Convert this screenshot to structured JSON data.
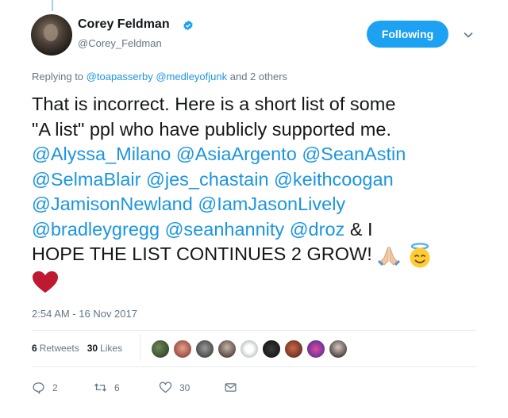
{
  "author": {
    "name": "Corey Feldman",
    "handle": "@Corey_Feldman"
  },
  "follow_button": "Following",
  "reply_context": {
    "prefix": "Replying to",
    "users": [
      "@toapasserby",
      "@medleyofjunk"
    ],
    "suffix": "and 2 others"
  },
  "tweet": {
    "line1": "That is incorrect. Here is a short list of some",
    "line2": "\"A list\" ppl who have publicly supported me.",
    "mentions": [
      "@Alyssa_Milano",
      "@AsiaArgento",
      "@SeanAstin",
      "@SelmaBlair",
      "@jes_chastain",
      "@keithcoogan",
      "@JamisonNewland",
      "@IamJasonLively",
      "@bradleygregg",
      "@seanhannity",
      "@droz"
    ],
    "tail_amp": "& I",
    "line_last": "HOPE THE LIST CONTINUES 2 GROW!",
    "emojis": [
      "folded-hands-emoji",
      "smiling-face-with-halo-emoji",
      "red-heart-emoji"
    ]
  },
  "timestamp": "2:54 AM - 16 Nov 2017",
  "stats": {
    "retweets_count": "6",
    "retweets_label": "Retweets",
    "likes_count": "30",
    "likes_label": "Likes"
  },
  "likers": 9,
  "actions": {
    "reply_count": "2",
    "retweet_count": "6",
    "like_count": "30"
  },
  "colors": {
    "accent": "#1da1f2",
    "link": "#1b95e0",
    "muted": "#657786"
  }
}
